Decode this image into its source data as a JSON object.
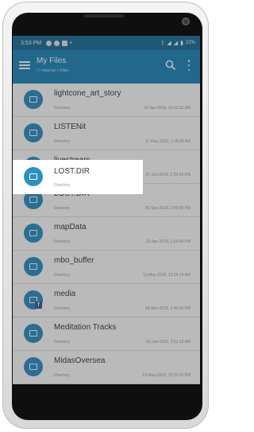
{
  "status_bar": {
    "time": "3:53 PM",
    "battery": "22%"
  },
  "app_bar": {
    "title": "My Files",
    "subtitle": "/ > Internal > Files"
  },
  "list": {
    "items": [
      {
        "name": "lightcone_art_story",
        "type": "Directory",
        "date": "16-Apr-2019, 10:02:31 AM",
        "icon": "folder-icon"
      },
      {
        "name": "LISTENit",
        "type": "Directory",
        "date": "11-May-2019, 1:18:24 AM",
        "icon": "folder-icon"
      },
      {
        "name": "livestream",
        "type": "Directory",
        "date": "27-Jan-2019, 1:29:34 PM",
        "icon": "folder-icon"
      },
      {
        "name": "LOST.DIR",
        "type": "Directory",
        "date": "26-Sep-2018, 2:55:58 PM",
        "icon": "folder-icon"
      },
      {
        "name": "mapData",
        "type": "Directory",
        "date": "19-Apr-2019, 1:02:49 PM",
        "icon": "folder-icon"
      },
      {
        "name": "mbo_buffer",
        "type": "Directory",
        "date": "11-May-2019, 12:24:15 AM",
        "icon": "folder-icon"
      },
      {
        "name": "media",
        "type": "Directory",
        "date": "08-Mar-2019, 2:45:28 PM",
        "icon": "folder-facebook-icon"
      },
      {
        "name": "Meditation Tracks",
        "type": "Directory",
        "date": "02-Jun-2019, 3:51:19 AM",
        "icon": "folder-icon"
      },
      {
        "name": "MidasOversea",
        "type": "Directory",
        "date": "13-May-2019, 12:22:16 PM",
        "icon": "folder-icon"
      }
    ]
  },
  "colors": {
    "appbar": "#1f87bd",
    "statusbar": "#1a6f9b",
    "folder_icon": "#2d8fc6"
  }
}
